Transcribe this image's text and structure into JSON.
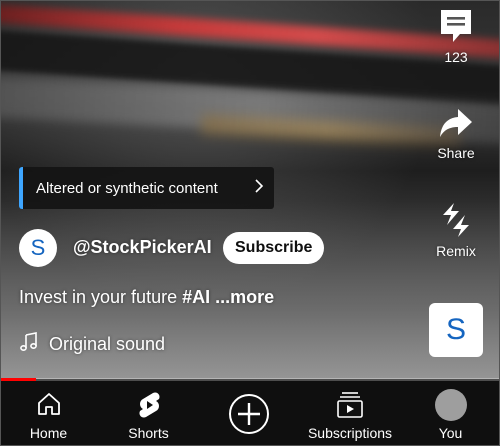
{
  "rail": {
    "comments": {
      "icon": "comment-icon",
      "count": "123"
    },
    "share": {
      "icon": "share-icon",
      "label": "Share"
    },
    "remix": {
      "icon": "remix-icon",
      "label": "Remix"
    },
    "thumb_letter": "S"
  },
  "altered_chip": {
    "label": "Altered or synthetic content",
    "icon": "chevron-right-icon"
  },
  "channel": {
    "avatar_letter": "S",
    "handle": "@StockPickerAI",
    "subscribe_label": "Subscribe"
  },
  "description": {
    "text": "Invest in your future ",
    "hashtag": "#AI",
    "more": " ...more"
  },
  "sound": {
    "icon": "music-note-icon",
    "label": "Original sound"
  },
  "progress": {
    "fraction": 0.07,
    "color": "#ff0000"
  },
  "nav": {
    "home": {
      "icon": "home-icon",
      "label": "Home"
    },
    "shorts": {
      "icon": "shorts-icon",
      "label": "Shorts"
    },
    "create": {
      "icon": "add-circle-icon"
    },
    "subscriptions": {
      "icon": "subscriptions-icon",
      "label": "Subscriptions"
    },
    "you": {
      "icon": "avatar",
      "label": "You"
    }
  },
  "colors": {
    "accent_blue": "#3ea6ff",
    "nav_bg": "#0f0f0f",
    "avatar_letter": "#1565c0"
  }
}
